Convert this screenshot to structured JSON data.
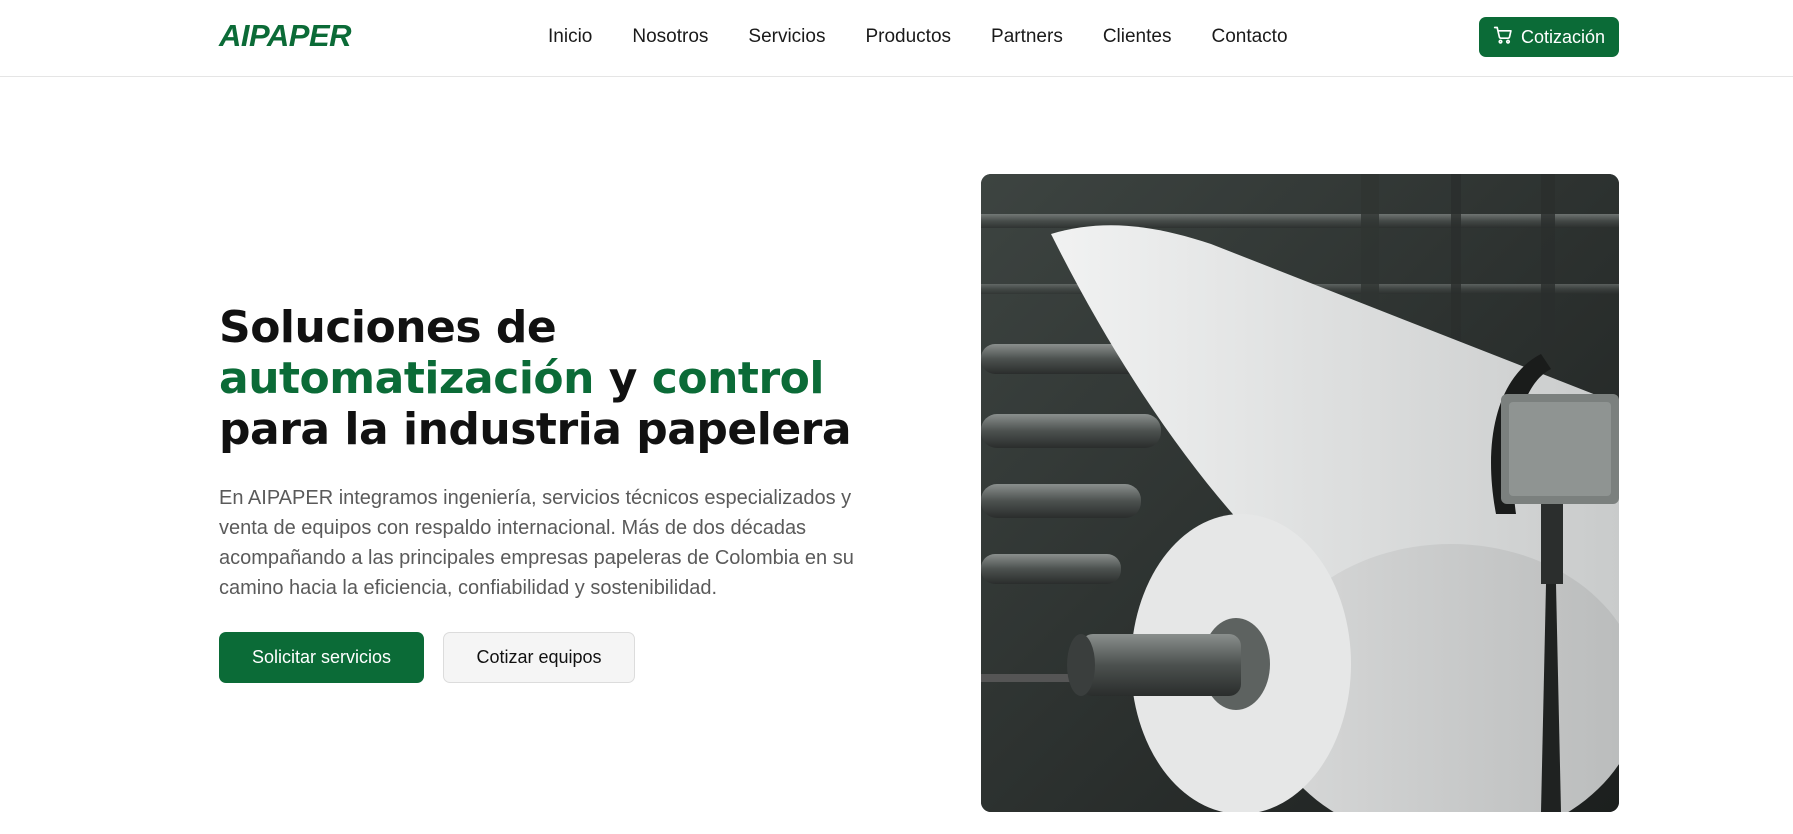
{
  "brand": {
    "logo_text": "AIPAPER",
    "accent_color": "#0b6b37"
  },
  "nav": {
    "items": [
      {
        "label": "Inicio"
      },
      {
        "label": "Nosotros"
      },
      {
        "label": "Servicios"
      },
      {
        "label": "Productos"
      },
      {
        "label": "Partners"
      },
      {
        "label": "Clientes"
      },
      {
        "label": "Contacto"
      }
    ],
    "cta": {
      "label": "Cotización",
      "icon": "shopping-cart-icon"
    }
  },
  "hero": {
    "title": {
      "line1": "Soluciones de",
      "highlight1": "automatización",
      "connector": " y ",
      "highlight2": "control",
      "line3": "para la industria papelera"
    },
    "description": "En AIPAPER integramos ingeniería, servicios técnicos especializados y venta de equipos con respaldo internacional. Más de dos décadas acompañando a las principales empresas papeleras de Colombia en su camino hacia la eficiencia, confiabilidad y sostenibilidad.",
    "primary_button": "Solicitar servicios",
    "secondary_button": "Cotizar equipos"
  }
}
